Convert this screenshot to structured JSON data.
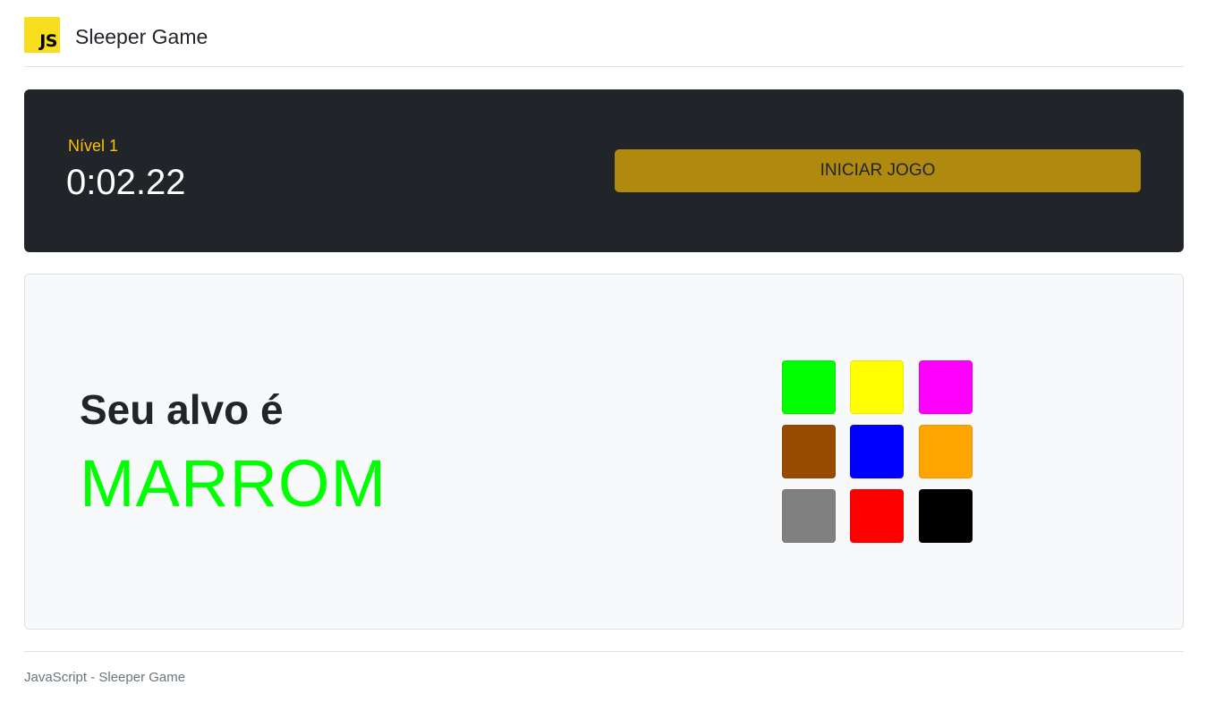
{
  "header": {
    "logo_text": "JS",
    "title": "Sleeper Game"
  },
  "status": {
    "level_label": "Nível 1",
    "timer": "0:02.22",
    "start_button_label": "INICIAR JOGO"
  },
  "game": {
    "target_label": "Seu alvo é",
    "target_word": "MARROM",
    "target_word_color": "#00ff00",
    "swatches": [
      {
        "color": "#00ff00"
      },
      {
        "color": "#ffff00"
      },
      {
        "color": "#ff00ff"
      },
      {
        "color": "#964b00"
      },
      {
        "color": "#0000ff"
      },
      {
        "color": "#ffa500"
      },
      {
        "color": "#808080"
      },
      {
        "color": "#ff0000"
      },
      {
        "color": "#000000"
      }
    ]
  },
  "footer": {
    "text": "JavaScript - Sleeper Game"
  },
  "colors": {
    "accent_yellow": "#ffc107",
    "button_gold": "#b0890f",
    "dark_panel": "#212529"
  }
}
